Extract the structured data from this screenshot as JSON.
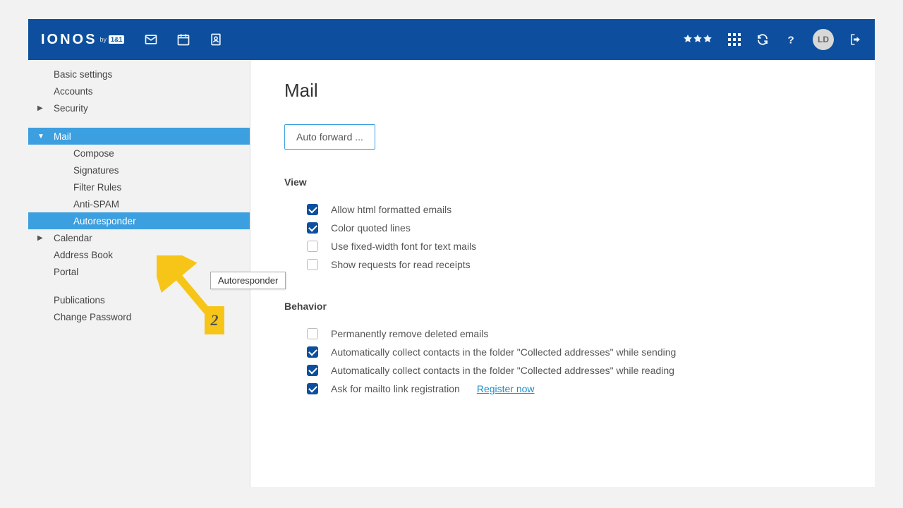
{
  "brand": {
    "name": "IONOS",
    "by": "by",
    "tag": "1&1"
  },
  "avatar_initials": "LD",
  "sidebar": {
    "items": [
      {
        "label": "Basic settings"
      },
      {
        "label": "Accounts"
      },
      {
        "label": "Security"
      },
      {
        "label": "Mail"
      },
      {
        "label": "Calendar"
      },
      {
        "label": "Address Book"
      },
      {
        "label": "Portal"
      },
      {
        "label": "Publications"
      },
      {
        "label": "Change Password"
      }
    ],
    "mail_children": [
      {
        "label": "Compose"
      },
      {
        "label": "Signatures"
      },
      {
        "label": "Filter Rules"
      },
      {
        "label": "Anti-SPAM"
      },
      {
        "label": "Autoresponder"
      }
    ]
  },
  "content": {
    "title": "Mail",
    "autoforward_btn": "Auto forward ...",
    "section_view": "View",
    "section_behavior": "Behavior",
    "view_options": [
      {
        "label": "Allow html formatted emails",
        "checked": true
      },
      {
        "label": "Color quoted lines",
        "checked": true
      },
      {
        "label": "Use fixed-width font for text mails",
        "checked": false
      },
      {
        "label": "Show requests for read receipts",
        "checked": false
      }
    ],
    "behavior_options": [
      {
        "label": "Permanently remove deleted emails",
        "checked": false
      },
      {
        "label": "Automatically collect contacts in the folder \"Collected addresses\" while sending",
        "checked": true
      },
      {
        "label": "Automatically collect contacts in the folder \"Collected addresses\" while reading",
        "checked": true
      },
      {
        "label": "Ask for mailto link registration",
        "checked": true,
        "link": "Register now"
      }
    ]
  },
  "annotation": {
    "tooltip": "Autoresponder",
    "step": "2"
  }
}
